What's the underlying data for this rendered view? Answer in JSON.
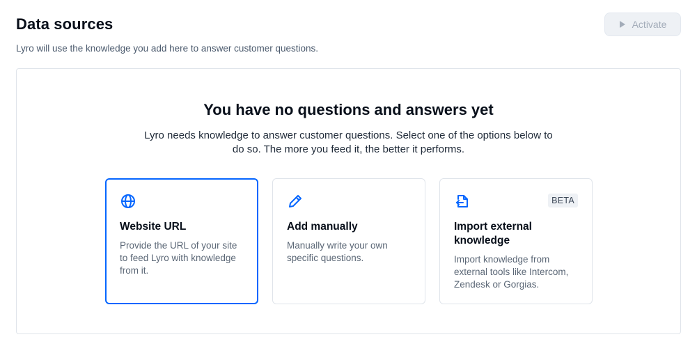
{
  "header": {
    "title": "Data sources",
    "subtitle": "Lyro will use the knowledge you add here to answer customer questions.",
    "activate_label": "Activate"
  },
  "empty_state": {
    "title": "You have no questions and answers yet",
    "description": "Lyro needs knowledge to answer customer questions. Select one of the options below to do so. The more you feed it, the better it performs."
  },
  "options": [
    {
      "icon": "globe-icon",
      "title": "Website URL",
      "description": "Provide the URL of your site to feed Lyro with knowledge from it.",
      "selected": true
    },
    {
      "icon": "pencil-icon",
      "title": "Add manually",
      "description": "Manually write your own specific questions.",
      "selected": false
    },
    {
      "icon": "import-file-icon",
      "title": "Import external knowledge",
      "description": "Import knowledge from external tools like Intercom, Zendesk or Gorgias.",
      "badge": "BETA",
      "selected": false
    }
  ],
  "colors": {
    "accent": "#0566ff",
    "text_primary": "#080f1a",
    "text_secondary": "#5b6776",
    "disabled": "#a3acb9"
  }
}
